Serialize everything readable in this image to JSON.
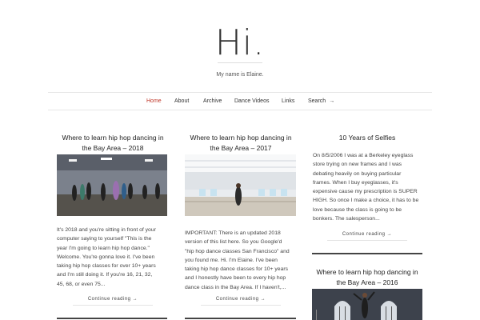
{
  "site": {
    "title": "Hi.",
    "tagline": "My name is Elaine."
  },
  "nav": {
    "home": "Home",
    "about": "About",
    "archive": "Archive",
    "dance_videos": "Dance Videos",
    "links": "Links",
    "search": "Search",
    "search_arrow": "→"
  },
  "posts": [
    {
      "title_line1": "Where to learn hip hop dancing in",
      "title_line2": "the Bay Area – 2018",
      "excerpt": [
        " It's 2018 and you're sitting in front of your",
        "computer saying to yourself \"This is the",
        "year I'm going to learn hip hop dance.\"",
        "Welcome. You're gonna love it. I've been",
        "taking hip hop classes for over 10+ years",
        "and I'm still doing it. If you're 16, 21, 32,",
        "45, 68, or even 75..."
      ],
      "more": "Continue reading →"
    },
    {
      "title_line1": "Where to learn hip hop dancing in",
      "title_line2": "the Bay Area – 2017",
      "excerpt": [
        "IMPORTANT: There is an updated 2018",
        "version of this list here. So you Google'd",
        "\"hip hop dance classes San Francisco\" and",
        "you found me. Hi. I'm Elaine. I've been",
        "taking hip hop dance classes for 10+ years",
        "and I honestly have been to every hip hop",
        "dance class in the Bay Area. If I haven't,..."
      ],
      "more": "Continue reading →"
    },
    {
      "title_line1": "10 Years of Selfies",
      "excerpt": [
        "On 8/5/2006 I was at a Berkeley eyeglass",
        "store trying on new frames and I was",
        "debating heavily on buying particular",
        "frames. When I buy eyeglasses, it's",
        "expensive cause my prescription is SUPER",
        "HIGH. So once I make a choice, it has to be",
        "love because the class is going to be",
        "bonkers. The salesperson..."
      ],
      "more": "Continue reading →"
    },
    {
      "title_line1": "Where to learn hip hop dancing in",
      "title_line2": "the Bay Area – 2016"
    }
  ],
  "colors": {
    "accent": "#c0392b",
    "text": "#333333",
    "rule": "#e6e6e6"
  }
}
